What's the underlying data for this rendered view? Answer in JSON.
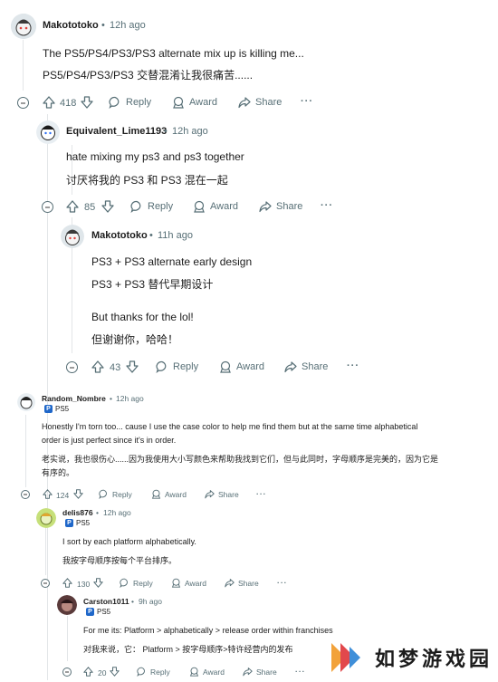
{
  "comments": [
    {
      "user": "Makototoko",
      "time": "12h ago",
      "lines": [
        "The PS5/PS4/PS3/PS3 alternate mix up is killing me...",
        "PS5/PS4/PS3/PS3 交替混淆让我很痛苦......"
      ],
      "votes": "418"
    },
    {
      "user": "Equivalent_Lime1193",
      "time": "12h ago",
      "lines": [
        "hate mixing my ps3 and ps3 together",
        "讨厌将我的 PS3 和 PS3 混在一起"
      ],
      "votes": "85"
    },
    {
      "user": "Makototoko",
      "time": "11h ago",
      "lines": [
        "PS3 + PS3 alternate early design",
        "PS3 + PS3 替代早期设计",
        "But thanks for the lol!",
        "但谢谢你，哈哈！"
      ],
      "votes": "43"
    },
    {
      "user": "Random_Nombre",
      "time": "12h ago",
      "flair": "PS5",
      "lines": [
        "Honestly I'm torn too... cause I use the case color to help me find them but at the same time alphabetical",
        "order is just perfect since it's in order.",
        "老实说，我也很伤心......因为我使用大小写颜色来帮助我找到它们，但与此同时，字母顺序是完美的，因为它是",
        "有序的。"
      ],
      "votes": "124"
    },
    {
      "user": "delis876",
      "time": "12h ago",
      "flair": "PS5",
      "lines": [
        "I sort by each platform alphabetically.",
        "我按字母顺序按每个平台排序。"
      ],
      "votes": "130"
    },
    {
      "user": "Carston1011",
      "time": "9h ago",
      "flair": "PS5",
      "lines": [
        "For me its: Platform > alphabetically > release order within franchises",
        "对我来说，它： Platform > 按字母顺序>特许经营内的发布"
      ],
      "votes": "20"
    }
  ],
  "actions": {
    "reply": "Reply",
    "award": "Award",
    "share": "Share",
    "more": "···"
  },
  "watermark": {
    "text": "如梦游戏园"
  },
  "colors": {
    "accent": "#0079d3",
    "meta": "#576f76",
    "flair": "#1f67c9"
  }
}
